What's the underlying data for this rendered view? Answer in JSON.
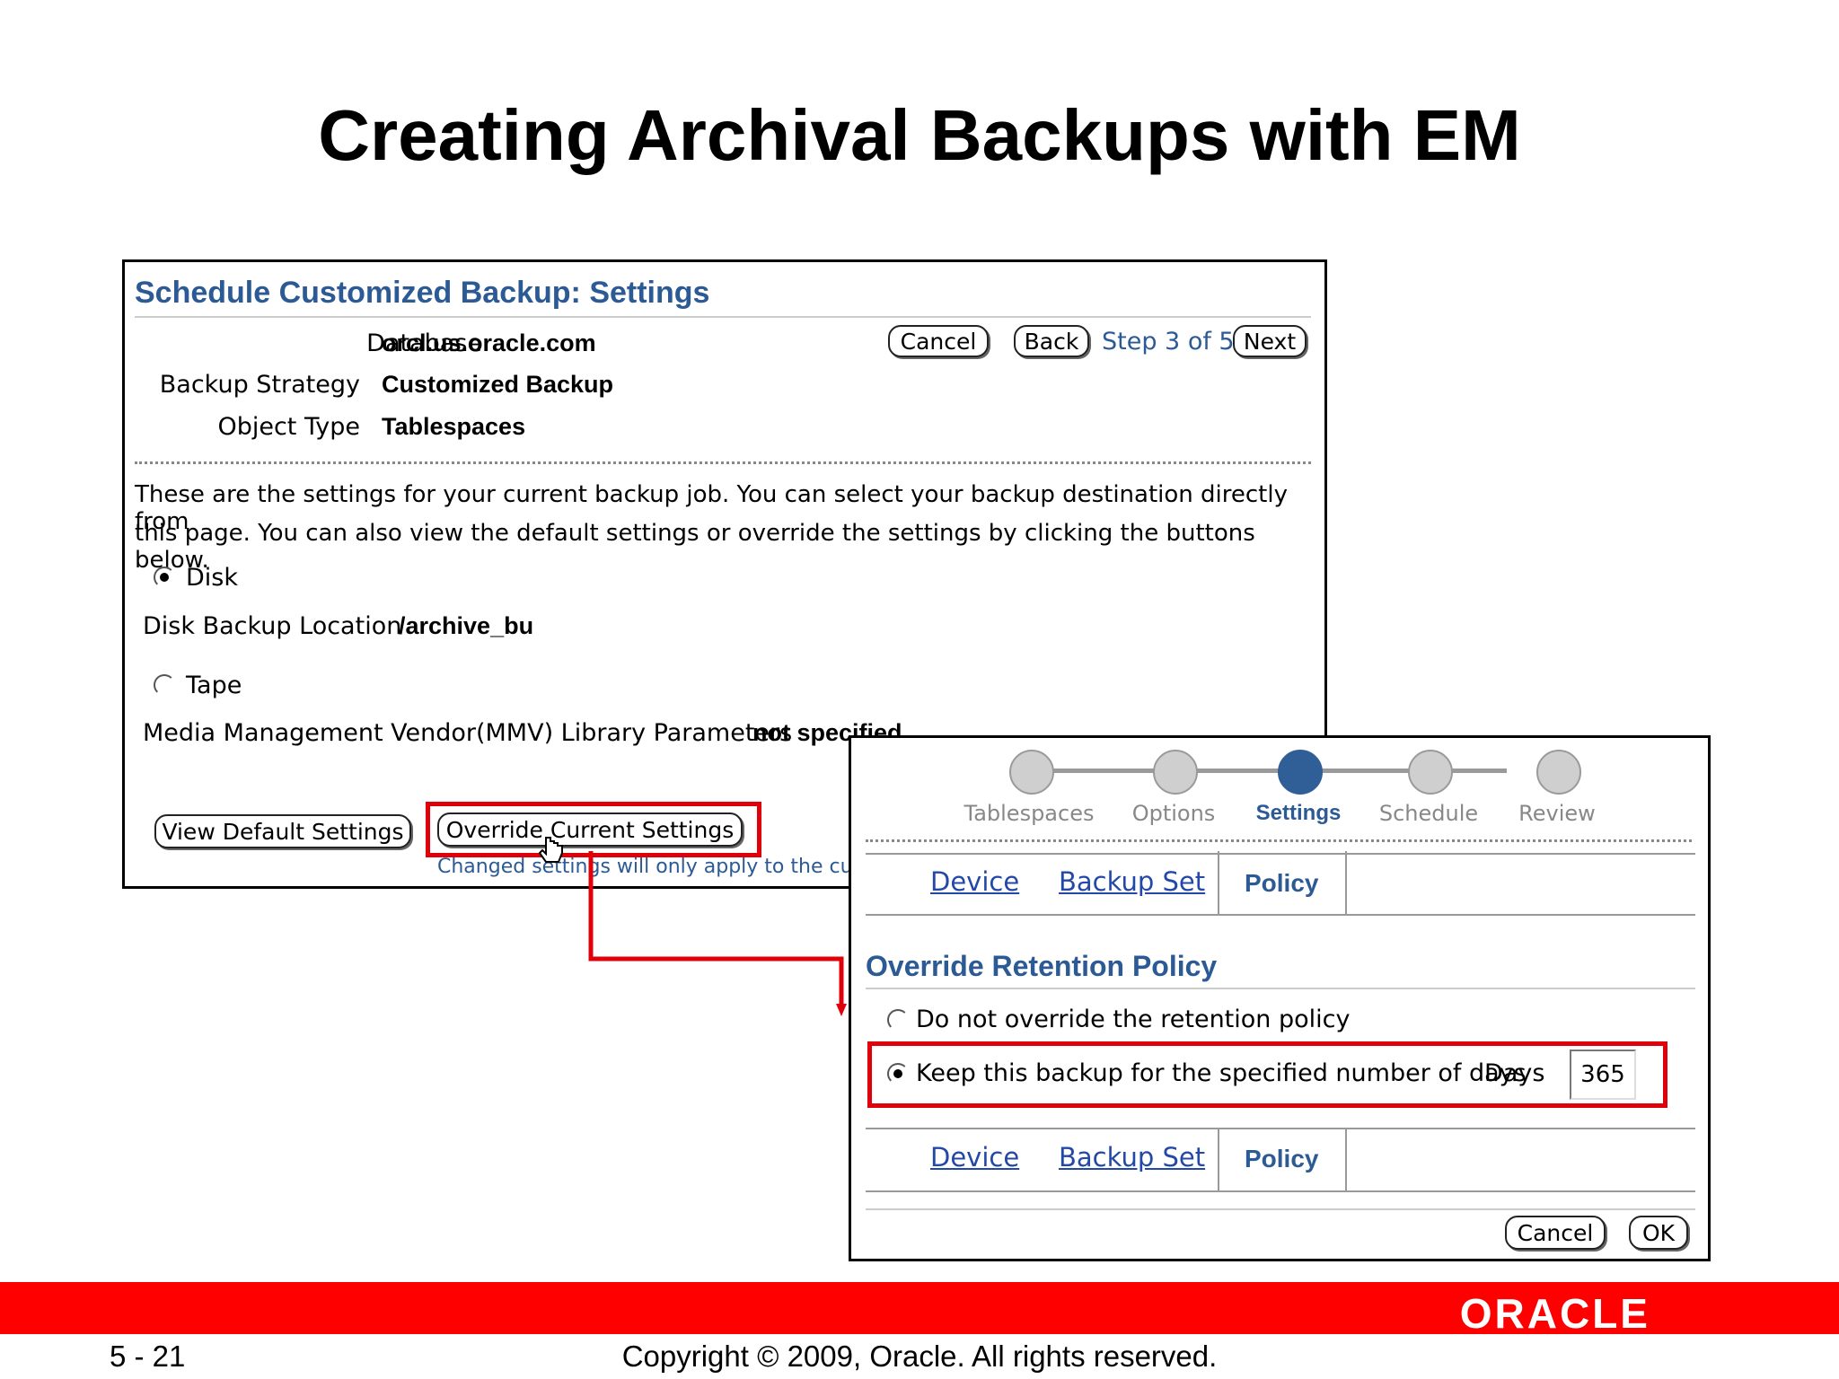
{
  "slide": {
    "title": "Creating Archival Backups with EM",
    "page_number": "5 - 21",
    "copyright": "Copyright © 2009, Oracle. All rights reserved.",
    "logo": "ORACLE"
  },
  "main": {
    "title": "Schedule Customized Backup: Settings",
    "fields": [
      {
        "label": "Database",
        "value": "orcl.us.oracle.com"
      },
      {
        "label": "Backup Strategy",
        "value": "Customized Backup"
      },
      {
        "label": "Object Type",
        "value": "Tablespaces"
      }
    ],
    "buttons": {
      "cancel": "Cancel",
      "back": "Back",
      "next": "Next"
    },
    "step": "Step 3 of 5",
    "description_line1": "These are the settings for your current backup job. You can select your backup destination directly from",
    "description_line2": "this page. You can also view the default settings or override the settings by clicking the buttons below.",
    "disk_label": "Disk",
    "disk_location_label": "Disk Backup Location",
    "disk_location_value": "/archive_bu",
    "tape_label": "Tape",
    "mmv_label": "Media Management Vendor(MMV) Library Parameters",
    "mmv_value": "not specified",
    "view_default": "View Default Settings",
    "override_current": "Override Current Settings",
    "changed_note": "Changed settings will only apply to the current"
  },
  "detail": {
    "train": [
      "Tablespaces",
      "Options",
      "Settings",
      "Schedule",
      "Review"
    ],
    "train_active": 2,
    "tabs": {
      "device": "Device",
      "backup_set": "Backup Set",
      "policy": "Policy"
    },
    "section_title": "Override Retention Policy",
    "option_no_override": "Do not override the retention policy",
    "option_keep": "Keep this backup for the specified number of days",
    "days_label": "Days",
    "days_value": "365",
    "buttons": {
      "cancel": "Cancel",
      "ok": "OK"
    }
  },
  "colors": {
    "accent_red": "#ff0000",
    "title_blue": "#2c5a94",
    "link_blue": "#2448a8"
  }
}
